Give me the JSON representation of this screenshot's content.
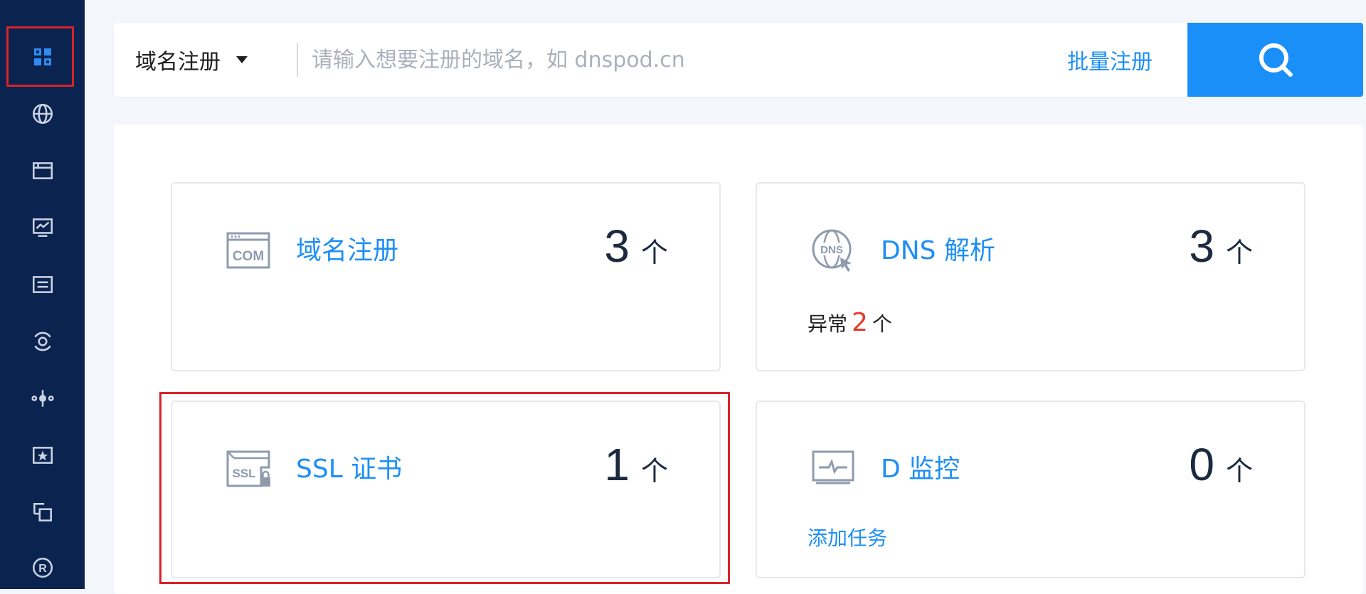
{
  "sidebar": {
    "items": [
      {
        "name": "dashboard",
        "icon": "grid-icon",
        "active": true
      },
      {
        "name": "domains",
        "icon": "globe-icon"
      },
      {
        "name": "window",
        "icon": "browser-window-icon"
      },
      {
        "name": "monitor",
        "icon": "monitor-chart-icon"
      },
      {
        "name": "list",
        "icon": "list-box-icon"
      },
      {
        "name": "target",
        "icon": "target-icon"
      },
      {
        "name": "nodes",
        "icon": "nodes-icon"
      },
      {
        "name": "favorite",
        "icon": "star-box-icon"
      },
      {
        "name": "transfer",
        "icon": "transfer-icon"
      },
      {
        "name": "trademark",
        "icon": "registered-icon"
      }
    ]
  },
  "search": {
    "type_label": "域名注册",
    "placeholder": "请输入想要注册的域名，如 dnspod.cn",
    "value": "",
    "bulk_label": "批量注册",
    "button_icon": "search-icon"
  },
  "cards": {
    "domain": {
      "title": "域名注册",
      "count": "3",
      "unit": "个",
      "icon": "com-icon"
    },
    "dns": {
      "title": "DNS 解析",
      "count": "3",
      "unit": "个",
      "icon": "dns-icon",
      "extra_label": "异常",
      "extra_count": "2",
      "extra_unit": "个"
    },
    "ssl": {
      "title": "SSL 证书",
      "count": "1",
      "unit": "个",
      "icon": "ssl-lock-icon"
    },
    "monitor": {
      "title": "D 监控",
      "count": "0",
      "unit": "个",
      "icon": "monitor-pulse-icon",
      "link": "添加任务"
    }
  },
  "colors": {
    "sidebar_bg": "#0b234f",
    "accent": "#1a8ff7",
    "warn": "#e23b2b",
    "highlight": "#d8232a"
  }
}
